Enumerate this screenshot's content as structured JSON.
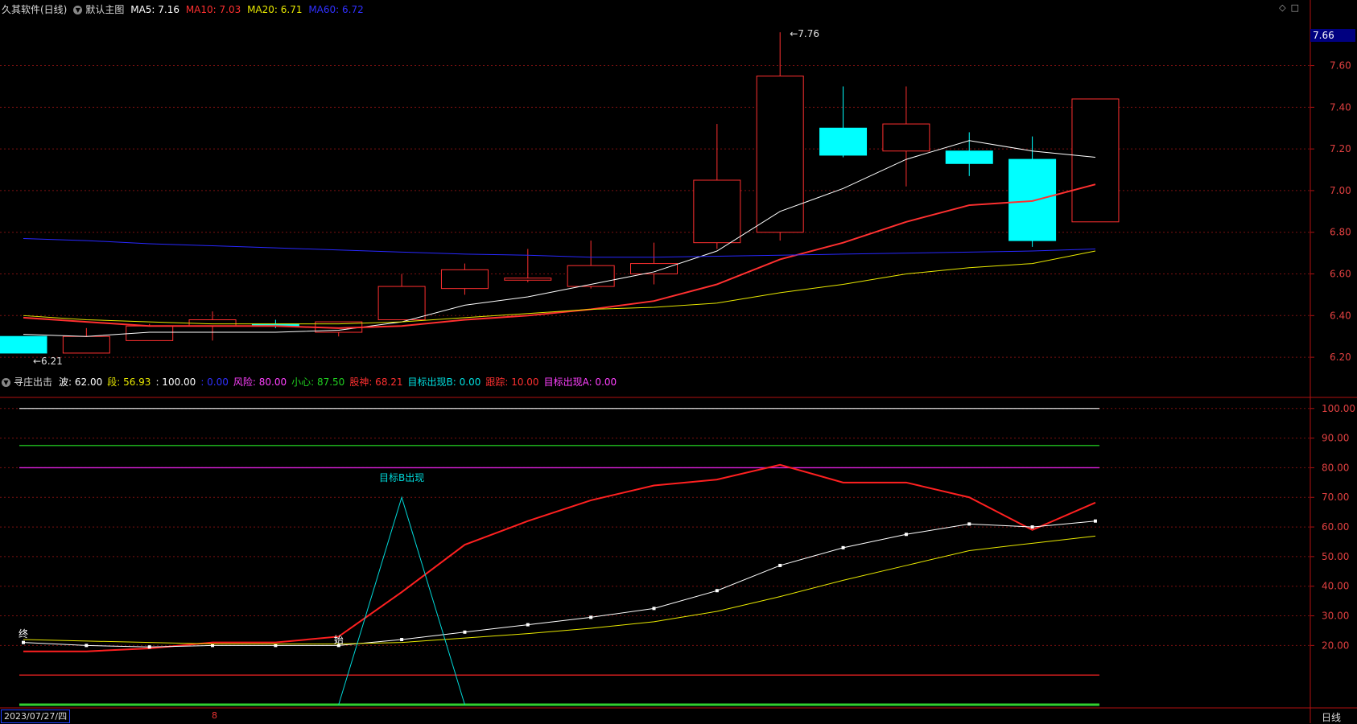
{
  "header_main": {
    "title": "久其软件(日线)",
    "template": "默认主图",
    "ma5": "MA5: 7.16",
    "ma10": "MA10: 7.03",
    "ma20": "MA20: 6.71",
    "ma60": "MA60: 6.72",
    "colors": {
      "title": "#d8d8d8",
      "ma5": "#ffffff",
      "ma10": "#ff3030",
      "ma20": "#e8e800",
      "ma60": "#3030ff"
    }
  },
  "header_sub": {
    "name": "寻庄出击",
    "items": [
      {
        "label": "波: 62.00",
        "color": "#ffffff"
      },
      {
        "label": "段: 56.93",
        "color": "#e8e800"
      },
      {
        "label": ": 100.00",
        "color": "#ffffff"
      },
      {
        "label": ": 0.00",
        "color": "#3030ff"
      },
      {
        "label": "风险: 80.00",
        "color": "#ff40ff"
      },
      {
        "label": "小心: 87.50",
        "color": "#20d020"
      },
      {
        "label": "股神: 68.21",
        "color": "#ff3030"
      },
      {
        "label": "目标出现B: 0.00",
        "color": "#00e0e0"
      },
      {
        "label": "跟踪: 10.00",
        "color": "#ff3030"
      },
      {
        "label": "目标出现A: 0.00",
        "color": "#ff40ff"
      }
    ]
  },
  "top_icons": [
    "diamond-icon",
    "square-icon"
  ],
  "last_price_label": "7.66",
  "date_label": "2023/07/27/四",
  "month_mark": "8",
  "period_label": "日线",
  "chart_data": [
    {
      "type": "candlestick",
      "title": "久其软件(日线)",
      "y_ticks": [
        "7.60",
        "7.40",
        "7.20",
        "7.00",
        "6.80",
        "6.60",
        "6.40",
        "6.20"
      ],
      "ylim": [
        6.1,
        7.83
      ],
      "up_color": "#ff3030",
      "down_color": "#00ffff",
      "candles": [
        {
          "o": 6.3,
          "h": 6.3,
          "l": 6.22,
          "c": 6.22
        },
        {
          "o": 6.22,
          "h": 6.34,
          "l": 6.22,
          "c": 6.3
        },
        {
          "o": 6.28,
          "h": 6.36,
          "l": 6.28,
          "c": 6.35
        },
        {
          "o": 6.35,
          "h": 6.42,
          "l": 6.28,
          "c": 6.38
        },
        {
          "o": 6.36,
          "h": 6.38,
          "l": 6.34,
          "c": 6.35
        },
        {
          "o": 6.32,
          "h": 6.37,
          "l": 6.3,
          "c": 6.37
        },
        {
          "o": 6.38,
          "h": 6.6,
          "l": 6.38,
          "c": 6.54
        },
        {
          "o": 6.53,
          "h": 6.65,
          "l": 6.5,
          "c": 6.62
        },
        {
          "o": 6.57,
          "h": 6.72,
          "l": 6.56,
          "c": 6.58
        },
        {
          "o": 6.54,
          "h": 6.76,
          "l": 6.53,
          "c": 6.64
        },
        {
          "o": 6.6,
          "h": 6.75,
          "l": 6.55,
          "c": 6.65
        },
        {
          "o": 6.75,
          "h": 7.32,
          "l": 6.72,
          "c": 7.05
        },
        {
          "o": 6.8,
          "h": 7.76,
          "l": 6.76,
          "c": 7.55
        },
        {
          "o": 7.3,
          "h": 7.5,
          "l": 7.16,
          "c": 7.17
        },
        {
          "o": 7.19,
          "h": 7.5,
          "l": 7.02,
          "c": 7.32
        },
        {
          "o": 7.19,
          "h": 7.28,
          "l": 7.07,
          "c": 7.13
        },
        {
          "o": 7.15,
          "h": 7.26,
          "l": 6.73,
          "c": 6.76
        },
        {
          "o": 6.85,
          "h": 7.44,
          "l": 6.85,
          "c": 7.44
        }
      ],
      "series": [
        {
          "name": "MA5",
          "color": "#ffffff",
          "values": [
            6.31,
            6.3,
            6.32,
            6.32,
            6.32,
            6.33,
            6.37,
            6.45,
            6.49,
            6.55,
            6.61,
            6.71,
            6.9,
            7.01,
            7.15,
            7.24,
            7.19,
            7.16
          ]
        },
        {
          "name": "MA10",
          "color": "#ff3030",
          "values": [
            6.39,
            6.37,
            6.35,
            6.35,
            6.35,
            6.34,
            6.35,
            6.38,
            6.4,
            6.43,
            6.47,
            6.55,
            6.67,
            6.75,
            6.85,
            6.93,
            6.95,
            7.03
          ]
        },
        {
          "name": "MA20",
          "color": "#e8e800",
          "values": [
            6.4,
            6.38,
            6.37,
            6.36,
            6.36,
            6.36,
            6.37,
            6.39,
            6.41,
            6.43,
            6.44,
            6.46,
            6.51,
            6.55,
            6.6,
            6.63,
            6.65,
            6.71
          ]
        },
        {
          "name": "MA60",
          "color": "#2828ff",
          "values": [
            6.77,
            6.76,
            6.745,
            6.735,
            6.725,
            6.715,
            6.705,
            6.695,
            6.69,
            6.68,
            6.68,
            6.685,
            6.69,
            6.695,
            6.7,
            6.705,
            6.71,
            6.72
          ]
        }
      ],
      "annotations": [
        {
          "text": "7.76",
          "candle": 12,
          "value": 7.76
        },
        {
          "text": "6.21",
          "candle": 0,
          "value": 6.22
        }
      ]
    },
    {
      "type": "line",
      "title": "寻庄出击",
      "y_ticks": [
        "100.00",
        "90.00",
        "80.00",
        "70.00",
        "60.00",
        "50.00",
        "40.00",
        "30.00",
        "20.00"
      ],
      "ylim": [
        0,
        107
      ],
      "hlines": [
        {
          "name": "100",
          "value": 100,
          "color": "#e0e0e0"
        },
        {
          "name": "小心",
          "value": 87.5,
          "color": "#20c020"
        },
        {
          "name": "风险",
          "value": 80,
          "color": "#e020e0"
        },
        {
          "name": "跟踪",
          "value": 10,
          "color": "#e02020"
        },
        {
          "name": "0",
          "value": 0,
          "color": "#30d030"
        }
      ],
      "series": [
        {
          "name": "股神",
          "color": "#ff2020",
          "values": [
            18,
            18,
            19,
            21,
            21,
            23,
            38,
            54,
            62,
            69,
            74,
            76,
            81,
            75,
            75,
            70,
            59,
            68.21
          ]
        },
        {
          "name": "波",
          "color": "#ffffff",
          "markers": true,
          "values": [
            21,
            20,
            19.5,
            20,
            20,
            20,
            22,
            24.5,
            27,
            29.5,
            32.5,
            38.5,
            47,
            53,
            57.5,
            61,
            60,
            62
          ]
        },
        {
          "name": "段",
          "color": "#e8e800",
          "values": [
            22,
            21.5,
            21,
            20.5,
            20.5,
            20.5,
            21,
            22.5,
            24,
            25.8,
            28,
            31.5,
            36.5,
            42,
            47,
            52,
            54.5,
            56.93
          ]
        },
        {
          "name": "目标出现B",
          "color": "#00d8d8",
          "values": [
            null,
            null,
            null,
            null,
            null,
            0,
            70,
            0,
            null,
            null,
            null,
            null,
            null,
            null,
            null,
            null,
            null,
            null
          ]
        }
      ],
      "annotations": [
        {
          "text": "目标B出现",
          "candle": 6,
          "value": 70
        },
        {
          "text": "终",
          "candle": 0,
          "value": 22
        },
        {
          "text": "始",
          "candle": 5,
          "value": 20
        }
      ]
    }
  ]
}
